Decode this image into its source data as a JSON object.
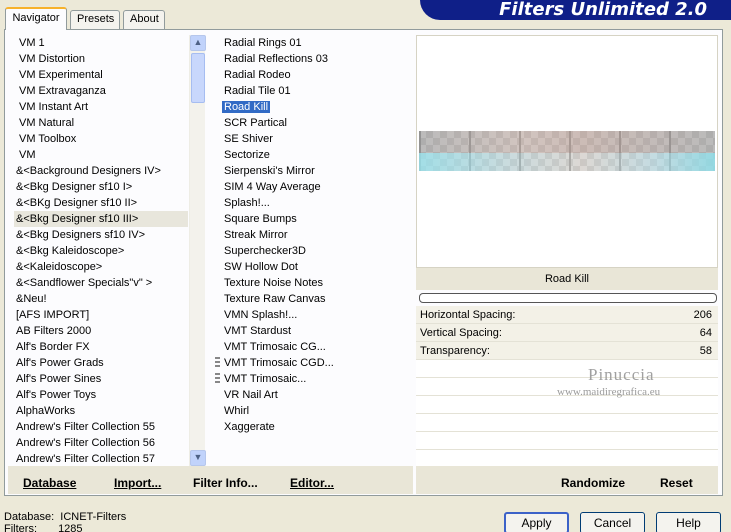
{
  "banner": {
    "title": "Filters Unlimited 2.0"
  },
  "tabs": [
    {
      "label": "Navigator",
      "active": true
    },
    {
      "label": "Presets",
      "active": false
    },
    {
      "label": "About",
      "active": false
    }
  ],
  "categories": [
    "VM 1",
    "VM Distortion",
    "VM Experimental",
    "VM Extravaganza",
    "VM Instant Art",
    "VM Natural",
    "VM Toolbox",
    "VM",
    "&<Background Designers IV>",
    "&<Bkg Designer sf10 I>",
    "&<BKg Designer sf10 II>",
    "&<Bkg Designer sf10 III>",
    "&<Bkg Designers sf10 IV>",
    "&<Bkg Kaleidoscope>",
    "&<Kaleidoscope>",
    "&<Sandflower Specials\"v\" >",
    "&Neu!",
    "[AFS IMPORT]",
    "AB Filters 2000",
    "Alf's Border FX",
    "Alf's Power Grads",
    "Alf's Power Sines",
    "Alf's Power Toys",
    "AlphaWorks",
    "Andrew's Filter Collection 55",
    "Andrew's Filter Collection 56",
    "Andrew's Filter Collection 57"
  ],
  "selected_category": "&<Bkg Designer sf10 III>",
  "filters": [
    "Radial  Rings 01",
    "Radial Reflections 03",
    "Radial Rodeo",
    "Radial Tile 01",
    "Road Kill",
    "SCR  Partical",
    "SE Shiver",
    "Sectorize",
    "Sierpenski's Mirror",
    "SIM 4 Way Average",
    "Splash!...",
    "Square Bumps",
    "Streak Mirror",
    "Superchecker3D",
    "SW Hollow Dot",
    "Texture Noise Notes",
    "Texture Raw Canvas",
    "VMN Splash!...",
    "VMT Stardust",
    "VMT Trimosaic CG...",
    "VMT Trimosaic CGD...",
    "VMT Trimosaic...",
    "VR Nail Art",
    "Whirl",
    "Xaggerate"
  ],
  "selected_filter": "Road Kill",
  "filter_name": "Road Kill",
  "parameters": [
    {
      "label": "Horizontal Spacing:",
      "value": "206"
    },
    {
      "label": "Vertical Spacing:",
      "value": "64"
    },
    {
      "label": "Transparency:",
      "value": "58"
    }
  ],
  "watermark": {
    "name": "Pinuccia",
    "site": "www.maidiregrafica.eu"
  },
  "toolbar": {
    "database": "Database",
    "import": "Import...",
    "filter_info": "Filter Info...",
    "editor": "Editor...",
    "randomize": "Randomize",
    "reset": "Reset"
  },
  "status": {
    "database_label": "Database:",
    "database_value": "ICNET-Filters",
    "filters_label": "Filters:",
    "filters_value": "1285"
  },
  "buttons": {
    "apply": "Apply",
    "cancel": "Cancel",
    "help": "Help"
  }
}
